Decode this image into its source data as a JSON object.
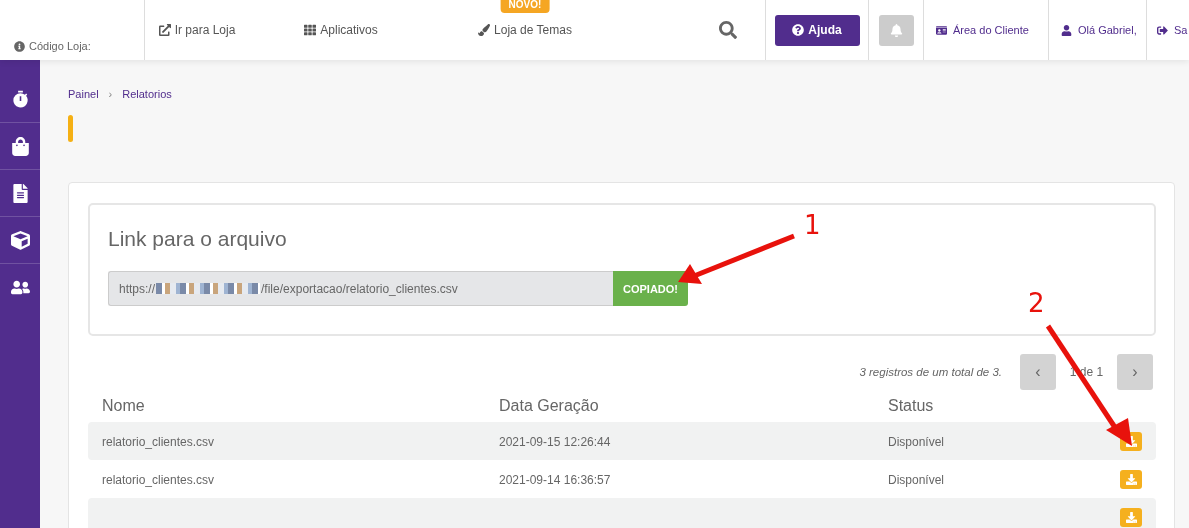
{
  "header": {
    "store_code_label": "Código Loja:",
    "nav": [
      {
        "label": "Ir para Loja"
      },
      {
        "label": "Aplicativos"
      },
      {
        "label": "Loja de Temas",
        "badge": "NOVO!"
      }
    ],
    "help_button": "Ajuda",
    "links": [
      "Área do Cliente",
      "Olá Gabriel,",
      "Sa"
    ]
  },
  "sidebar": {
    "items": [
      {
        "kind": "timer"
      },
      {
        "kind": "bag"
      },
      {
        "kind": "document"
      },
      {
        "kind": "box"
      },
      {
        "kind": "people"
      }
    ]
  },
  "breadcrumb": [
    "Painel",
    "Relatorios"
  ],
  "breadcrumb_separator": "›",
  "link_box": {
    "title": "Link para o arquivo",
    "url_prefix": "https://",
    "url_suffix": "/file/exportacao/relatorio_clientes.csv",
    "copy_button": "COPIADO!"
  },
  "pagination": {
    "summary": "3 registros de um total de 3.",
    "prev": "‹",
    "page": "1 de 1",
    "next": "›"
  },
  "table": {
    "columns": [
      "Nome",
      "Data Geração",
      "Status"
    ],
    "rows": [
      {
        "name": "relatorio_clientes.csv",
        "date": "2021-09-15 12:26:44",
        "status": "Disponível"
      },
      {
        "name": "relatorio_clientes.csv",
        "date": "2021-09-14 16:36:57",
        "status": "Disponível"
      },
      {}
    ]
  },
  "annotations": [
    "1",
    "2"
  ]
}
